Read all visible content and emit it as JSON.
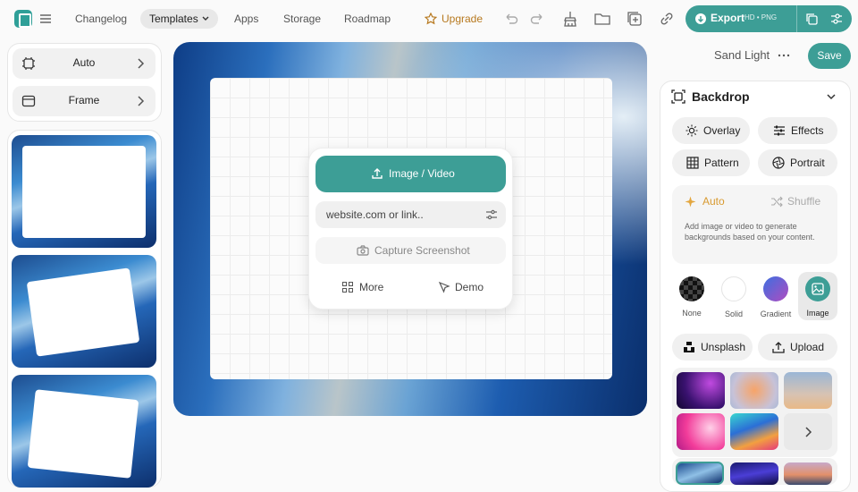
{
  "nav": {
    "changelog": "Changelog",
    "templates": "Templates",
    "apps": "Apps",
    "storage": "Storage",
    "roadmap": "Roadmap",
    "upgrade": "Upgrade"
  },
  "export": {
    "label": "Export",
    "format": "HD • PNG"
  },
  "left": {
    "auto": "Auto",
    "frame": "Frame"
  },
  "center": {
    "upload": "Image / Video",
    "link_placeholder": "website.com or link..",
    "capture": "Capture Screenshot",
    "more": "More",
    "demo": "Demo"
  },
  "right": {
    "theme": "Sand Light",
    "save": "Save",
    "section": "Backdrop",
    "overlay": "Overlay",
    "effects": "Effects",
    "pattern": "Pattern",
    "portrait": "Portrait",
    "auto": "Auto",
    "shuffle": "Shuffle",
    "auto_desc": "Add image or video to generate backgrounds based on your content.",
    "types": [
      "None",
      "Solid",
      "Gradient",
      "Image"
    ],
    "unsplash": "Unsplash",
    "upload": "Upload"
  },
  "colors": {
    "accent": "#3d9e96",
    "upgrade": "#b7791f"
  }
}
